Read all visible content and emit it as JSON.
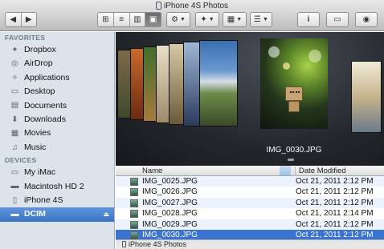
{
  "window": {
    "title": "iPhone 4S Photos"
  },
  "toolbar": {
    "view_icons": [
      "icon-view-icon",
      "list-view-icon",
      "column-view-icon",
      "coverflow-view-icon"
    ],
    "action_glyph": "⚙",
    "dropbox_glyph": "✦",
    "arrange_glyph": "▦",
    "share_glyph": "☰",
    "info_glyph": "i",
    "newfolder_glyph": "▭",
    "quicklook_glyph": "◉"
  },
  "sidebar": {
    "favorites_label": "FAVORITES",
    "devices_label": "DEVICES",
    "favorites": [
      {
        "label": "Dropbox",
        "icon": "✦"
      },
      {
        "label": "AirDrop",
        "icon": "◎"
      },
      {
        "label": "Applications",
        "icon": "✧"
      },
      {
        "label": "Desktop",
        "icon": "▭"
      },
      {
        "label": "Documents",
        "icon": "▤"
      },
      {
        "label": "Downloads",
        "icon": "⬇"
      },
      {
        "label": "Movies",
        "icon": "▦"
      },
      {
        "label": "Music",
        "icon": "♫"
      }
    ],
    "devices": [
      {
        "label": "My iMac",
        "icon": "▭"
      },
      {
        "label": "Macintosh HD 2",
        "icon": "▬"
      },
      {
        "label": "iPhone 4S",
        "icon": "▯"
      },
      {
        "label": "DCIM",
        "icon": "▬"
      }
    ],
    "eject_glyph": "⏏"
  },
  "coverflow": {
    "caption": "IMG_0030.JPG"
  },
  "list": {
    "col_name": "Name",
    "col_date": "Date Modified",
    "rows": [
      {
        "name": "IMG_0025.JPG",
        "date": "Oct 21, 2011 2:12 PM"
      },
      {
        "name": "IMG_0026.JPG",
        "date": "Oct 21, 2011 2:12 PM"
      },
      {
        "name": "IMG_0027.JPG",
        "date": "Oct 21, 2011 2:12 PM"
      },
      {
        "name": "IMG_0028.JPG",
        "date": "Oct 21, 2011 2:14 PM"
      },
      {
        "name": "IMG_0029.JPG",
        "date": "Oct 21, 2011 2:12 PM"
      },
      {
        "name": "IMG_0030.JPG",
        "date": "Oct 21, 2011 2:12 PM"
      }
    ],
    "selected_index": 5
  },
  "pathbar": {
    "label": "iPhone 4S Photos"
  }
}
